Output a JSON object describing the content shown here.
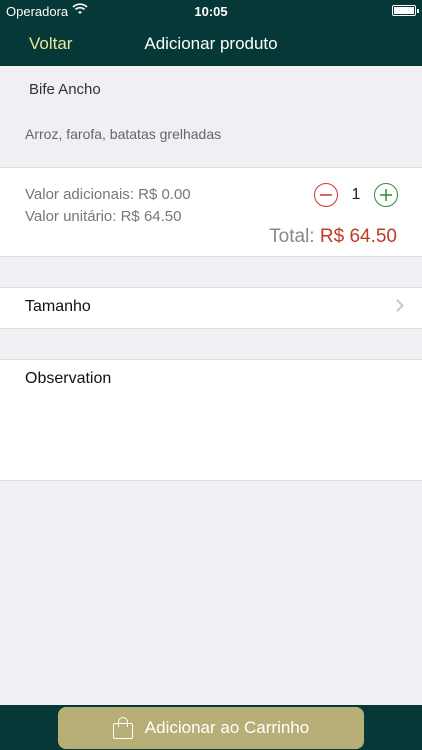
{
  "status_bar": {
    "carrier": "Operadora",
    "time": "10:05"
  },
  "navbar": {
    "back_label": "Voltar",
    "title": "Adicionar produto"
  },
  "product": {
    "name": "Bife Ancho",
    "description": "Arroz, farofa, batatas grelhadas"
  },
  "pricing": {
    "adicionais": "Valor adicionais: R$ 0.00",
    "unitario": "Valor unitário: R$ 64.50",
    "quantity": "1",
    "total_label": "Total:",
    "total_value": "R$ 64.50"
  },
  "options": {
    "size_label": "Tamanho",
    "observation_label": "Observation"
  },
  "footer": {
    "add_to_cart_label": "Adicionar ao Carrinho"
  },
  "colors": {
    "brand_dark": "#053836",
    "back_accent": "#e8e6a0",
    "button_gold": "#b8ae77",
    "price_red": "#c0392b",
    "minus_red": "#d0342c",
    "plus_green": "#2e8b32"
  }
}
